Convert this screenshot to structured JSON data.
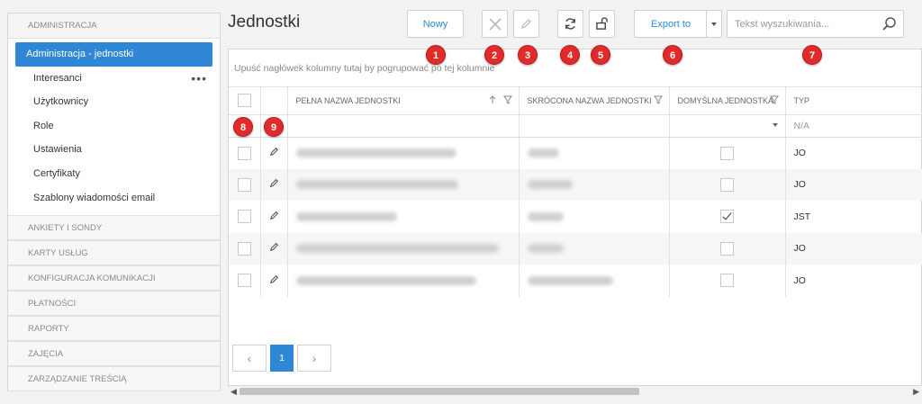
{
  "sidebar": {
    "section_admin": "ADMINISTRACJA",
    "items": [
      {
        "label": "Administracja - jednostki",
        "active": true
      },
      {
        "label": "Interesanci",
        "more": "•••"
      },
      {
        "label": "Użytkownicy"
      },
      {
        "label": "Role"
      },
      {
        "label": "Ustawienia"
      },
      {
        "label": "Certyfikaty"
      },
      {
        "label": "Szablony wiadomości email"
      }
    ],
    "sections": [
      "ANKIETY I SONDY",
      "KARTY USŁUG",
      "KONFIGURACJA KOMUNIKACJI",
      "PŁATNOŚCI",
      "RAPORTY",
      "ZAJĘCIA",
      "ZARZĄDZANIE TREŚCIĄ"
    ]
  },
  "main": {
    "title": "Jednostki",
    "toolbar": {
      "new_label": "Nowy",
      "export_label": "Export to",
      "search_placeholder": "Tekst wyszukiwania..."
    },
    "grid": {
      "group_hint": "Upuść nagłówek kolumny tutaj by pogrupować po tej kolumnie",
      "columns": {
        "full_name": "PEŁNA NAZWA JEDNOSTKI",
        "short_name": "SKRÓCONA NAZWA JEDNOSTKI",
        "default_unit": "DOMYŚLNA JEDNOSTKA",
        "type": "TYP"
      },
      "filter_type_value": "N/A",
      "rows": [
        {
          "default": false,
          "type": "JO"
        },
        {
          "default": false,
          "type": "JO"
        },
        {
          "default": true,
          "type": "JST"
        },
        {
          "default": false,
          "type": "JO"
        },
        {
          "default": false,
          "type": "JO"
        }
      ]
    },
    "pager": {
      "current_page": "1"
    }
  },
  "annotations": [
    "1",
    "2",
    "3",
    "4",
    "5",
    "6",
    "7",
    "8",
    "9"
  ],
  "colors": {
    "accent": "#2f87d6",
    "badge": "#e12b2b"
  }
}
